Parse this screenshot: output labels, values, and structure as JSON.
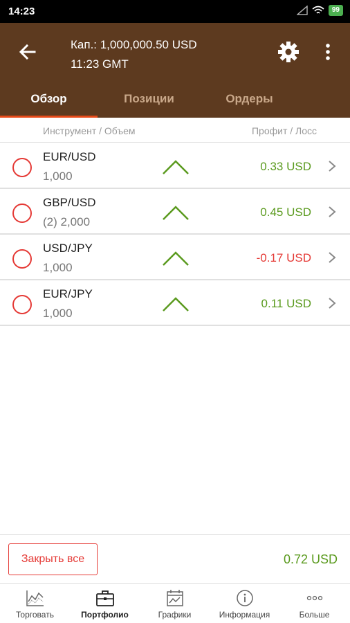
{
  "status": {
    "time": "14:23",
    "battery": "99"
  },
  "header": {
    "capital": "Кап.: 1,000,000.50 USD",
    "time": "11:23 GMT"
  },
  "tabs": [
    {
      "label": "Обзор",
      "active": true
    },
    {
      "label": "Позиции",
      "active": false
    },
    {
      "label": "Ордеры",
      "active": false
    }
  ],
  "columns": {
    "instrument": "Инструмент / Объем",
    "pl": "Профит / Лосс"
  },
  "rows": [
    {
      "symbol": "EUR/USD",
      "volume": "1,000",
      "pl": "0.33 USD",
      "pl_color": "#5a9a1e"
    },
    {
      "symbol": "GBP/USD",
      "volume": "(2) 2,000",
      "pl": "0.45 USD",
      "pl_color": "#5a9a1e"
    },
    {
      "symbol": "USD/JPY",
      "volume": "1,000",
      "pl": "-0.17 USD",
      "pl_color": "#e53935"
    },
    {
      "symbol": "EUR/JPY",
      "volume": "1,000",
      "pl": "0.11 USD",
      "pl_color": "#5a9a1e"
    }
  ],
  "footer": {
    "close_all": "Закрыть все",
    "total": "0.72 USD"
  },
  "nav": [
    {
      "label": "Торговать",
      "icon": "trade-chart-icon"
    },
    {
      "label": "Портфолио",
      "icon": "briefcase-icon",
      "active": true
    },
    {
      "label": "Графики",
      "icon": "calendar-chart-icon"
    },
    {
      "label": "Информация",
      "icon": "info-icon"
    },
    {
      "label": "Больше",
      "icon": "more-dots-icon"
    }
  ],
  "colors": {
    "appbar": "#5d3a1f",
    "accent": "#e64a19",
    "positive": "#5a9a1e",
    "negative": "#e53935"
  }
}
